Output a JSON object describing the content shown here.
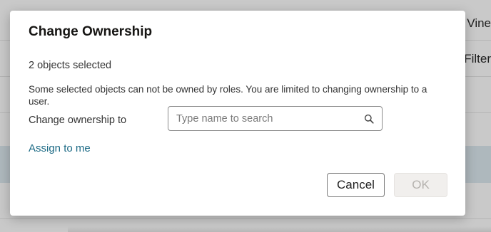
{
  "background": {
    "row1_text": "Vine",
    "row2_text": "Filter"
  },
  "dialog": {
    "title": "Change Ownership",
    "selected_count": "2 objects selected",
    "notice": "Some selected objects can not be owned by roles. You are limited to changing ownership to a user.",
    "field_label": "Change ownership to",
    "search": {
      "value": "",
      "placeholder": "Type name to search",
      "icon": "search-icon"
    },
    "assign_link": "Assign to me",
    "buttons": {
      "cancel": "Cancel",
      "ok": "OK"
    }
  },
  "colors": {
    "link": "#1c6a85",
    "disabled_button_bg": "#f1efed",
    "disabled_button_text": "#b5b2ae"
  }
}
